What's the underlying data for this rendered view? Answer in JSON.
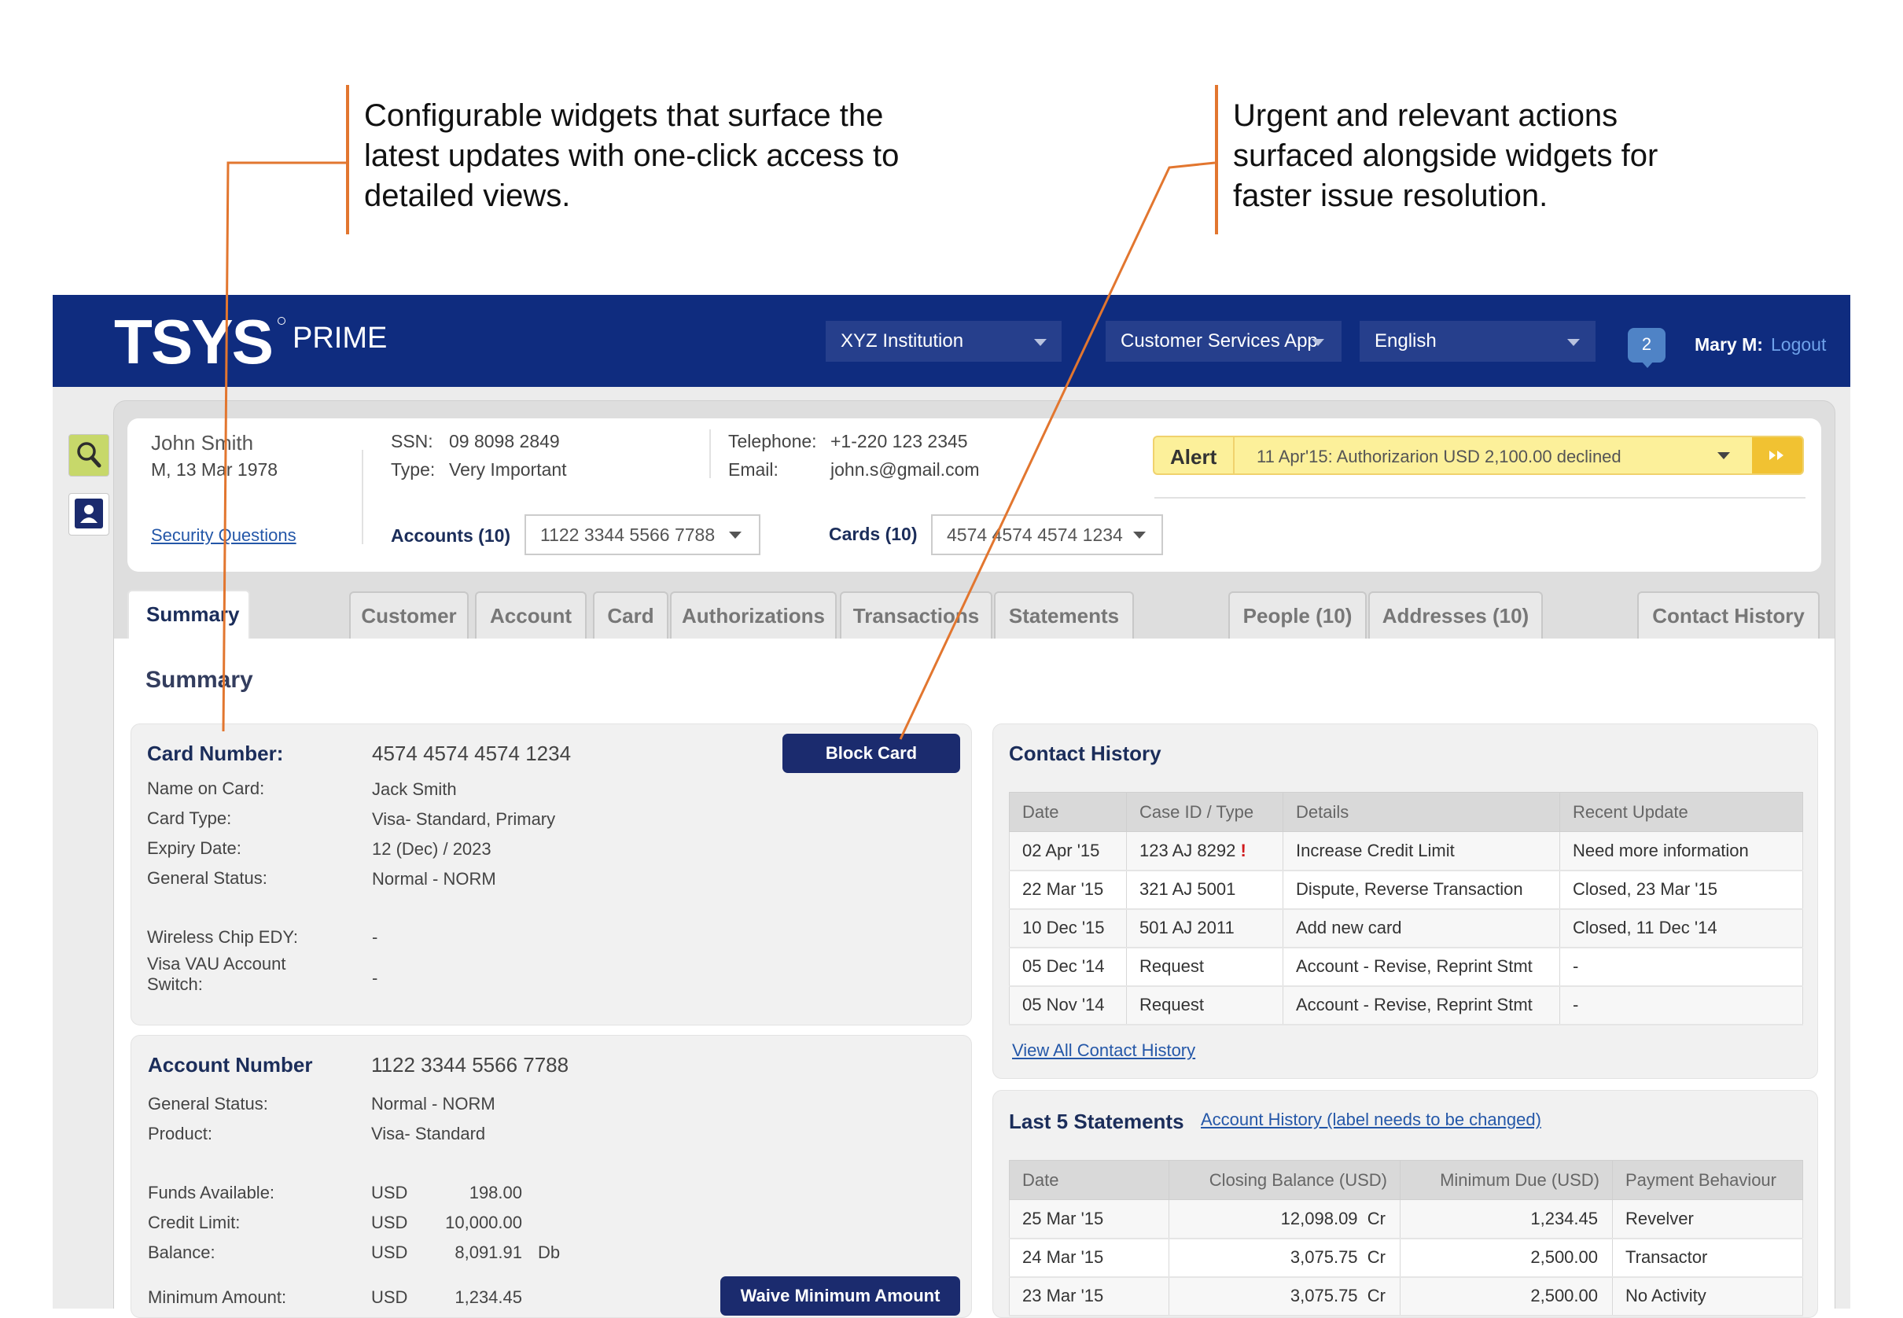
{
  "annotations": {
    "left": [
      "Configurable widgets that surface the",
      "latest updates with one-click access to",
      "detailed views."
    ],
    "right": [
      "Urgent and relevant actions",
      "surfaced alongside widgets for",
      "faster issue resolution."
    ]
  },
  "colors": {
    "brand": "#0f2c7f",
    "accent_line": "#e2762f",
    "alert_bg": "#fcf09a",
    "alert_accent": "#f1c232",
    "link": "#2457a8",
    "exclamation": "#d0191c"
  },
  "appbar": {
    "logo": "TSYS",
    "product": "PRIME",
    "institution": "XYZ Institution",
    "app": "Customer Services App",
    "language": "English",
    "notifications": "2",
    "user": "Mary M:",
    "logout": "Logout"
  },
  "rail": {
    "icons": [
      "search-icon",
      "person-icon"
    ]
  },
  "customer": {
    "name": "John Smith",
    "meta": "M, 13 Mar 1978",
    "security_link": "Security Questions",
    "ssn_label": "SSN:",
    "ssn": "09 8098 2849",
    "type_label": "Type:",
    "type": "Very Important",
    "tel_label": "Telephone:",
    "tel": "+1-220 123 2345",
    "email_label": "Email:",
    "email": "john.s@gmail.com",
    "accounts_label": "Accounts (10)",
    "account_selected": "1122 3344 5566 7788",
    "cards_label": "Cards (10)",
    "card_selected": "4574 4574 4574 1234"
  },
  "alert": {
    "label": "Alert",
    "message": "11 Apr'15: Authorizarion USD 2,100.00 declined"
  },
  "tabs": [
    "Summary",
    "Customer",
    "Account",
    "Card",
    "Authorizations",
    "Transactions",
    "Statements",
    "People (10)",
    "Addresses (10)",
    "Contact History"
  ],
  "summary_title": "Summary",
  "card_widget": {
    "title": "Card Number:",
    "number": "4574 4574 4574 1234",
    "button": "Block Card",
    "rows": [
      {
        "label": "Name on Card:",
        "value": "Jack Smith"
      },
      {
        "label": "Card Type:",
        "value": "Visa- Standard, Primary"
      },
      {
        "label": "Expiry Date:",
        "value": "12 (Dec) / 2023"
      },
      {
        "label": "General Status:",
        "value": "Normal - NORM"
      },
      {
        "label": "Wireless Chip EDY:",
        "value": "-"
      },
      {
        "label": "Visa VAU Account",
        "value": ""
      },
      {
        "label": "Switch:",
        "value": "-"
      }
    ]
  },
  "account_widget": {
    "title": "Account Number",
    "number": "1122 3344 5566 7788",
    "rows": [
      {
        "label": "General Status:",
        "value": "Normal - NORM"
      },
      {
        "label": "Product:",
        "value": "Visa- Standard"
      }
    ],
    "money": [
      {
        "label": "Funds Available:",
        "cur": "USD",
        "amount": "198.00",
        "suffix": ""
      },
      {
        "label": "Credit Limit:",
        "cur": "USD",
        "amount": "10,000.00",
        "suffix": ""
      },
      {
        "label": "Balance:",
        "cur": "USD",
        "amount": "8,091.91",
        "suffix": "Db"
      },
      {
        "label": "Minimum Amount:",
        "cur": "USD",
        "amount": "1,234.45",
        "suffix": ""
      }
    ],
    "button": "Waive Minimum Amount"
  },
  "contact_history": {
    "title": "Contact History",
    "columns": [
      "Date",
      "Case ID / Type",
      "Details",
      "Recent Update"
    ],
    "rows": [
      {
        "date": "02 Apr '15",
        "case": "123 AJ 8292",
        "flag": "!",
        "details": "Increase Credit Limit",
        "update": "Need more information"
      },
      {
        "date": "22 Mar '15",
        "case": "321 AJ 5001",
        "flag": "",
        "details": "Dispute, Reverse Transaction",
        "update": "Closed, 23 Mar '15"
      },
      {
        "date": "10 Dec '15",
        "case": "501 AJ 2011",
        "flag": "",
        "details": "Add new card",
        "update": "Closed, 11 Dec '14"
      },
      {
        "date": "05 Dec '14",
        "case": "Request",
        "flag": "",
        "details": "Account - Revise, Reprint Stmt",
        "update": "-"
      },
      {
        "date": "05 Nov '14",
        "case": "Request",
        "flag": "",
        "details": "Account - Revise, Reprint Stmt",
        "update": "-"
      }
    ],
    "link": "View All Contact History"
  },
  "statements": {
    "title": "Last 5 Statements",
    "link": "Account History (label needs to be changed)",
    "columns": [
      "Date",
      "Closing Balance (USD)",
      "Minimum Due (USD)",
      "Payment Behaviour"
    ],
    "rows": [
      {
        "date": "25 Mar '15",
        "closing": "12,098.09",
        "cr": "Cr",
        "min": "1,234.45",
        "behaviour": "Revelver"
      },
      {
        "date": "24 Mar '15",
        "closing": "3,075.75",
        "cr": "Cr",
        "min": "2,500.00",
        "behaviour": "Transactor"
      },
      {
        "date": "23 Mar '15",
        "closing": "3,075.75",
        "cr": "Cr",
        "min": "2,500.00",
        "behaviour": "No Activity"
      }
    ]
  }
}
